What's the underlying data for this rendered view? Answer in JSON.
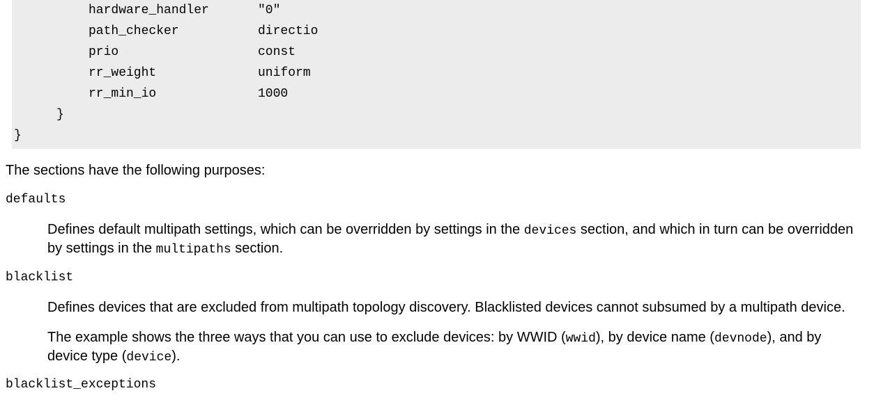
{
  "code": {
    "rows": [
      {
        "key": "hardware_handler",
        "value": "\"0\""
      },
      {
        "key": "path_checker",
        "value": "directio"
      },
      {
        "key": "prio",
        "value": "const"
      },
      {
        "key": "rr_weight",
        "value": "uniform"
      },
      {
        "key": "rr_min_io",
        "value": "1000"
      }
    ],
    "inner_close": "}",
    "outer_close": "}"
  },
  "intro": "The sections have the following purposes:",
  "defaults": {
    "term": "defaults",
    "desc_1": "Defines default multipath settings, which can be overridden by settings in the ",
    "code_1": "devices",
    "desc_2": " section, and which in turn can be overridden by settings in the ",
    "code_2": "multipaths",
    "desc_3": " section."
  },
  "blacklist": {
    "term": "blacklist",
    "para1": "Defines devices that are excluded from multipath topology discovery. Blacklisted devices cannot subsumed by a multipath device.",
    "p2_a": "The example shows the three ways that you can use to exclude devices: by WWID (",
    "p2_code1": "wwid",
    "p2_b": "), by device name (",
    "p2_code2": "devnode",
    "p2_c": "), and by device type (",
    "p2_code3": "device",
    "p2_d": ")."
  },
  "blacklist_exceptions": {
    "term": "blacklist_exceptions"
  }
}
